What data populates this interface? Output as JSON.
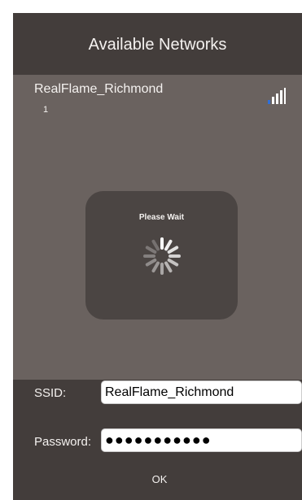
{
  "dialog": {
    "title": "Available Networks"
  },
  "networks": [
    {
      "name": "RealFlame_Richmond",
      "index": "1",
      "signal_icon": "wifi-signal-bars-icon"
    }
  ],
  "hud": {
    "text": "Please Wait",
    "icon": "loading-spinner-icon"
  },
  "form": {
    "ssid_label": "SSID:",
    "ssid_value": "RealFlame_Richmond",
    "password_label": "Password:",
    "password_value": "●●●●●●●●●●●"
  },
  "actions": {
    "ok_label": "OK"
  },
  "colors": {
    "dialog_bg": "#433d3b",
    "list_bg": "#6a625f",
    "hud_bg": "#4b4543",
    "text": "#f4f1ef",
    "signal_accent": "#2f6fd8"
  }
}
